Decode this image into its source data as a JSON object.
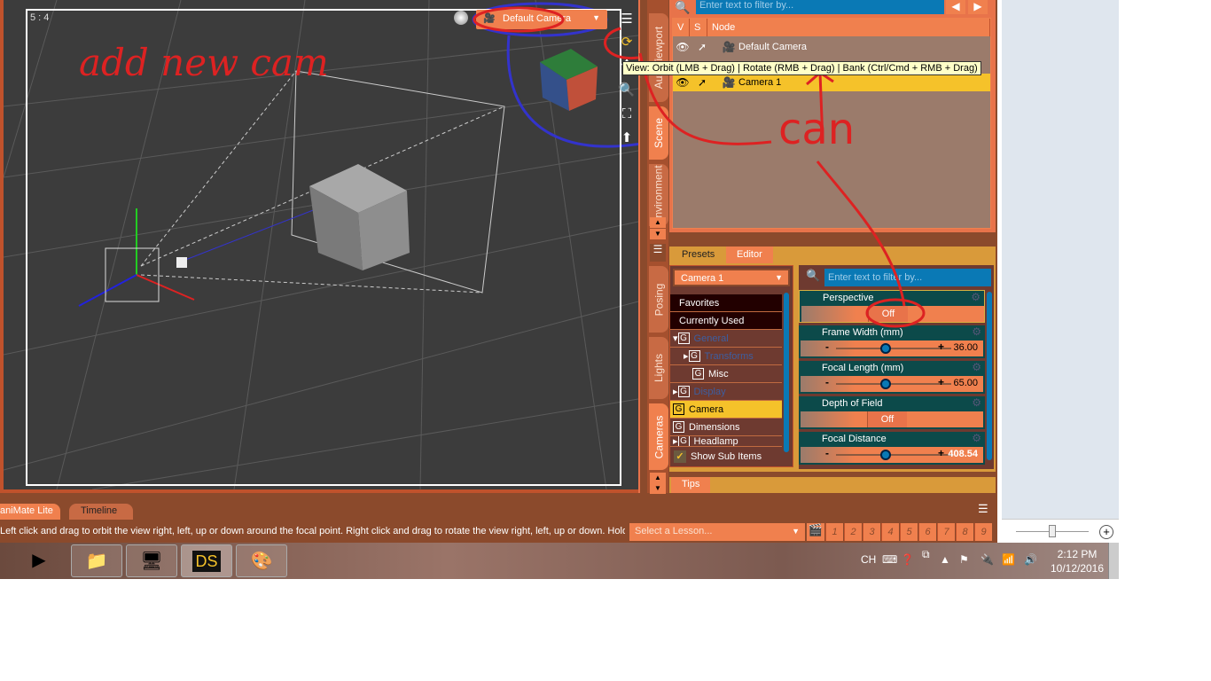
{
  "viewport": {
    "aspect_ratio": "5 : 4",
    "camera_select": "Default Camera",
    "tooltip": "View: Orbit (LMB + Drag) | Rotate (RMB + Drag) | Bank (Ctrl/Cmd + RMB + Drag)"
  },
  "annotations": {
    "text1": "add new cam",
    "text2": "can"
  },
  "side_tabs": [
    "Aux Viewport",
    "Scene",
    "Environment",
    "Posing",
    "Lights",
    "Cameras"
  ],
  "scene": {
    "filter_placeholder": "Enter text to filter by...",
    "columns": [
      "V",
      "S",
      "Node"
    ],
    "rows": [
      {
        "label": "Default Camera",
        "selected": false
      },
      {
        "label": "Camera 1",
        "selected": true
      }
    ]
  },
  "params": {
    "tabs": [
      "Presets",
      "Editor"
    ],
    "node_select": "Camera 1",
    "filter_placeholder": "Enter text to filter by...",
    "categories": [
      "Favorites",
      "Currently Used",
      "General",
      "Transforms",
      "Misc",
      "Display",
      "Camera",
      "Dimensions",
      "Headlamp"
    ],
    "show_sub_items": "Show Sub Items",
    "properties": [
      {
        "label": "Perspective",
        "type": "toggle",
        "value": "Off"
      },
      {
        "label": "Frame Width (mm)",
        "type": "slider",
        "value": "36.00",
        "fraction": 0.5
      },
      {
        "label": "Focal Length (mm)",
        "type": "slider",
        "value": "65.00",
        "fraction": 0.5
      },
      {
        "label": "Depth of Field",
        "type": "toggle",
        "value": "Off"
      },
      {
        "label": "Focal Distance",
        "type": "slider",
        "value": "408.54",
        "fraction": 0.5
      }
    ],
    "tips_tab": "Tips"
  },
  "bottom": {
    "tabs": [
      "aniMate Lite",
      "Timeline"
    ],
    "status": "Left click and drag to orbit the view right, left, up or down around the focal point. Right click and drag to rotate the view right, left, up or down. Hold ...",
    "lesson_select": "Select a Lesson...",
    "lesson_numbers": [
      "1",
      "2",
      "3",
      "4",
      "5",
      "6",
      "7",
      "8",
      "9"
    ]
  },
  "taskbar": {
    "lang": "CH",
    "time": "2:12 PM",
    "date": "10/12/2016"
  }
}
